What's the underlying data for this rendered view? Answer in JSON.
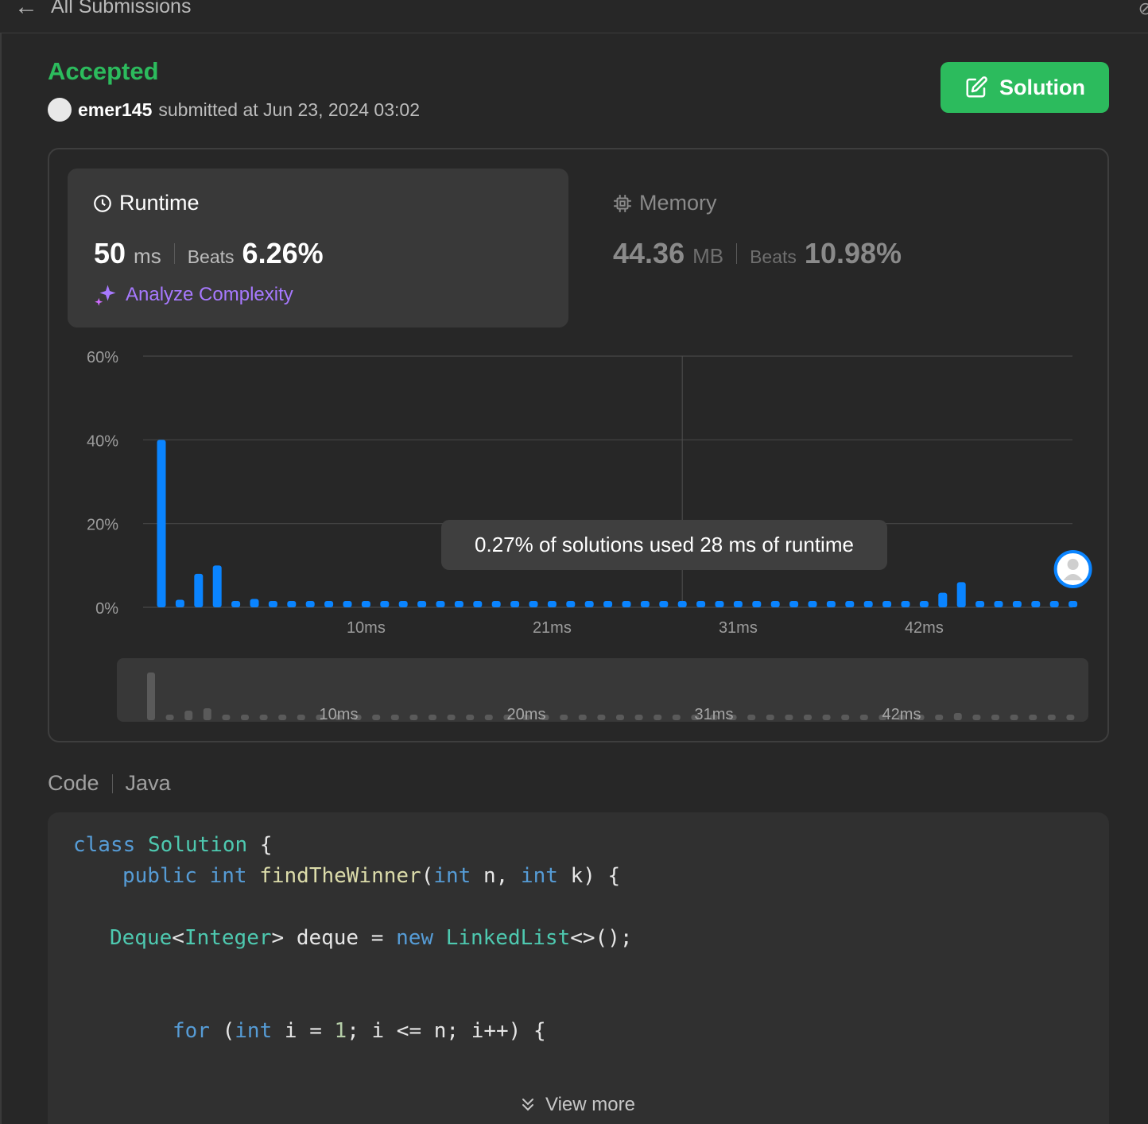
{
  "header": {
    "back_label": "All Submissions"
  },
  "submission": {
    "status": "Accepted",
    "username": "emer145",
    "submitted_text": "submitted at Jun 23, 2024 03:02"
  },
  "solution_button": {
    "label": "Solution"
  },
  "runtime": {
    "label": "Runtime",
    "value": "50",
    "unit": "ms",
    "beats_label": "Beats",
    "beats": "6.26%",
    "analyze_label": "Analyze Complexity"
  },
  "memory": {
    "label": "Memory",
    "value": "44.36",
    "unit": "MB",
    "beats_label": "Beats",
    "beats": "10.98%"
  },
  "tooltip": {
    "text": "0.27% of solutions used 28 ms of runtime"
  },
  "chart_data": {
    "type": "bar",
    "ylabel": "",
    "xlabel": "",
    "yticks": [
      "0%",
      "20%",
      "40%",
      "60%"
    ],
    "ylim": [
      0,
      60
    ],
    "x_tick_labels": [
      "10ms",
      "21ms",
      "31ms",
      "42ms"
    ],
    "x_tick_positions": [
      11,
      21,
      31,
      41
    ],
    "grid": true,
    "highlight_index": 28,
    "user_marker_index": 49,
    "values": [
      40,
      1.8,
      8,
      10,
      1.5,
      2,
      1.5,
      1.5,
      1.5,
      1.5,
      1.5,
      1.5,
      1.5,
      1.5,
      1.5,
      1.5,
      1.5,
      1.5,
      1.5,
      1.5,
      1.5,
      1.5,
      1.5,
      1.5,
      1.5,
      1.5,
      1.5,
      1.5,
      1.5,
      1.5,
      1.5,
      1.5,
      1.5,
      1.5,
      1.5,
      1.5,
      1.5,
      1.5,
      1.5,
      1.5,
      1.5,
      1.5,
      3.5,
      6,
      1.5,
      1.5,
      1.5,
      1.5,
      1.5,
      1.5
    ],
    "overview": {
      "x_tick_labels": [
        "10ms",
        "20ms",
        "31ms",
        "42ms"
      ],
      "x_tick_positions": [
        10,
        20,
        30,
        40
      ]
    }
  },
  "code": {
    "label": "Code",
    "language": "Java",
    "lines": [
      "class Solution {",
      "public int findTheWinner(int n, int k) {",
      "Deque<Integer> deque = new LinkedList<>();",
      "for (int i = 1; i <= n; i++) {"
    ],
    "view_more": "View more"
  },
  "colors": {
    "accent_green": "#2cbb5d",
    "bar_blue": "#0a84ff",
    "purple": "#a779ff"
  }
}
